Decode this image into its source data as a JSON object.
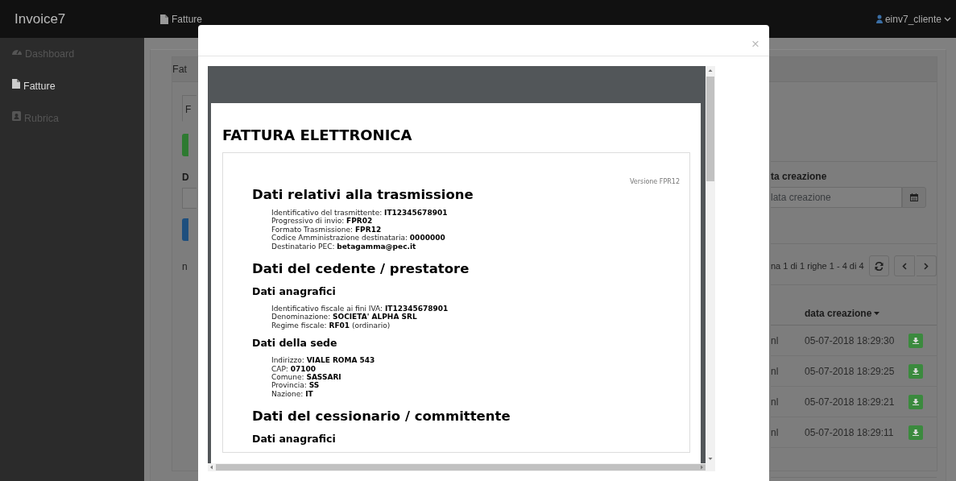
{
  "navbar": {
    "brand": "Invoice7",
    "page": "Fatture",
    "user": "einv7_cliente"
  },
  "sidebar": {
    "items": [
      {
        "label": "Dashboard",
        "selected": false
      },
      {
        "label": "Fatture",
        "selected": true
      },
      {
        "label": "Rubrica",
        "selected": false
      }
    ]
  },
  "background": {
    "card_title": "Fat",
    "tab": "F",
    "left_label": "D",
    "left_text": "n",
    "date_label": "ta creazione",
    "date_placeholder": "lata creazione",
    "pagination": "na 1 di 1 righe 1 - 4 di 4",
    "sort_column": "data creazione",
    "rows": [
      {
        "column_1": "nl",
        "created": "05-07-2018 18:29:30"
      },
      {
        "column_1": "nl",
        "created": "05-07-2018 18:29:25"
      },
      {
        "column_1": "nl",
        "created": "05-07-2018 18:29:21"
      },
      {
        "column_1": "nl",
        "created": "05-07-2018 18:29:11"
      }
    ]
  },
  "modal": {
    "close": "×",
    "document": {
      "title": "FATTURA ELETTRONICA",
      "version": "Versione FPR12",
      "blocks": [
        {
          "kind": "heading",
          "text": "Dati relativi alla trasmissione"
        },
        {
          "kind": "fields",
          "lines": [
            "Identificativo del trasmittente: **IT12345678901**",
            "Progressivo di invio: **FPR02**",
            "Formato Trasmissione: **FPR12**",
            "Codice Amministrazione destinataria: **0000000**",
            "Destinatario PEC: **betagamma@pec.it**"
          ]
        },
        {
          "kind": "heading",
          "text": "Dati del cedente / prestatore"
        },
        {
          "kind": "subheading",
          "text": "Dati anagrafici"
        },
        {
          "kind": "fields",
          "lines": [
            "Identificativo fiscale ai fini IVA: **IT12345678901**",
            "Denominazione: **SOCIETA' ALPHA SRL**",
            "Regime fiscale: **RF01** (ordinario)"
          ]
        },
        {
          "kind": "subheading",
          "text": "Dati della sede"
        },
        {
          "kind": "fields",
          "lines": [
            "Indirizzo: **VIALE ROMA 543**",
            "CAP: **07100**",
            "Comune: **SASSARI**",
            "Provincia: **SS**",
            "Nazione: **IT**"
          ]
        },
        {
          "kind": "heading",
          "text": "Dati del cessionario / committente"
        },
        {
          "kind": "subheading",
          "text": "Dati anagrafici"
        }
      ]
    }
  }
}
